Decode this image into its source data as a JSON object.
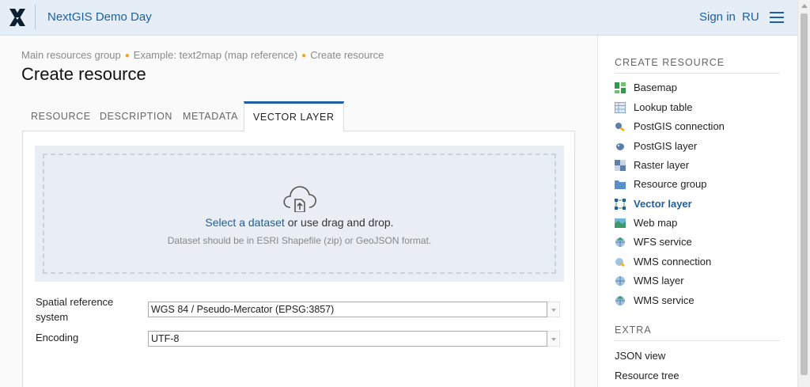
{
  "header": {
    "app_title": "NextGIS Demo Day",
    "signin_label": "Sign in",
    "lang_label": "RU",
    "colors": {
      "bar": "#e5eef7",
      "accent": "#1f5fa0"
    }
  },
  "breadcrumb": {
    "items": [
      "Main resources group",
      "Example: text2map (map reference)",
      "Create resource"
    ]
  },
  "page_title": "Create resource",
  "tabs": [
    {
      "label": "RESOURCE"
    },
    {
      "label": "DESCRIPTION"
    },
    {
      "label": "METADATA"
    },
    {
      "label": "VECTOR LAYER",
      "active": true
    }
  ],
  "upload": {
    "link_text": "Select a dataset",
    "rest_text": " or use drag and drop.",
    "hint": "Dataset should be in ESRI Shapefile (zip) or GeoJSON format.",
    "icon": "cloud-upload-icon"
  },
  "form": {
    "srs_label_line1": "Spatial reference",
    "srs_label_line2": "system",
    "srs_value": "WGS 84 / Pseudo-Mercator (EPSG:3857)",
    "encoding_label": "Encoding",
    "encoding_value": "UTF-8"
  },
  "sidebar": {
    "create_heading": "CREATE RESOURCE",
    "items": [
      {
        "label": "Basemap",
        "icon": "basemap-icon"
      },
      {
        "label": "Lookup table",
        "icon": "lookup-table-icon"
      },
      {
        "label": "PostGIS connection",
        "icon": "postgis-connection-icon"
      },
      {
        "label": "PostGIS layer",
        "icon": "postgis-layer-icon"
      },
      {
        "label": "Raster layer",
        "icon": "raster-layer-icon"
      },
      {
        "label": "Resource group",
        "icon": "folder-icon"
      },
      {
        "label": "Vector layer",
        "icon": "vector-layer-icon",
        "active": true
      },
      {
        "label": "Web map",
        "icon": "web-map-icon"
      },
      {
        "label": "WFS service",
        "icon": "wfs-service-icon"
      },
      {
        "label": "WMS connection",
        "icon": "wms-connection-icon"
      },
      {
        "label": "WMS layer",
        "icon": "wms-layer-icon"
      },
      {
        "label": "WMS service",
        "icon": "wms-service-icon"
      }
    ],
    "extra_heading": "EXTRA",
    "extra_items": [
      {
        "label": "JSON view"
      },
      {
        "label": "Resource tree"
      }
    ]
  }
}
